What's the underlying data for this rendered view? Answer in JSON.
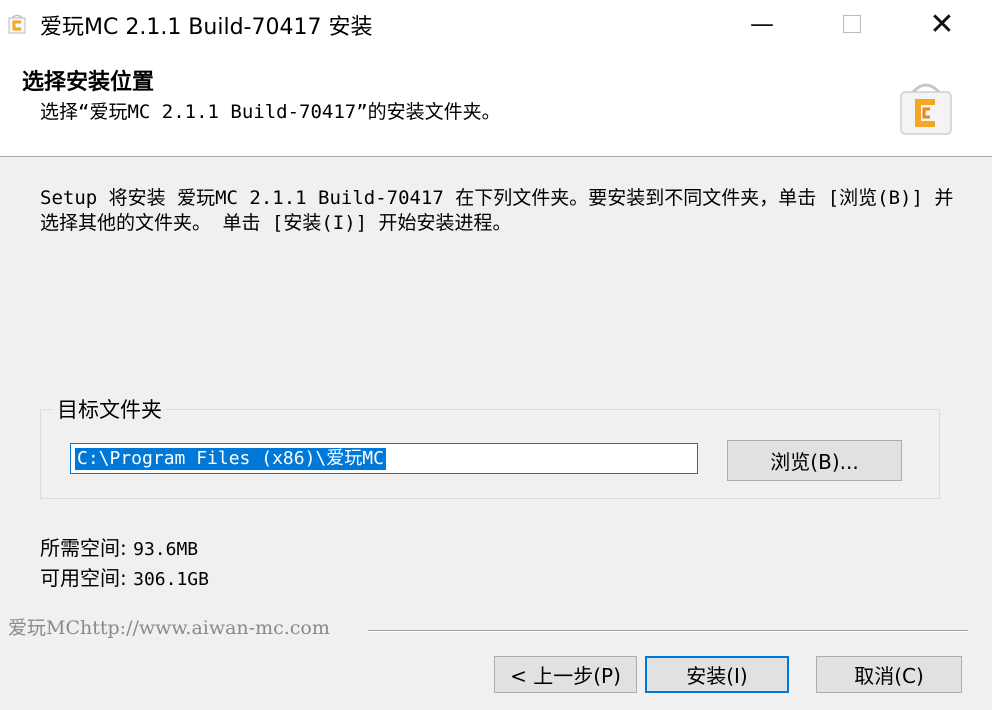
{
  "window": {
    "title": "爱玩MC 2.1.1 Build-70417 安装",
    "minimize_glyph": "—",
    "close_glyph": "✕"
  },
  "header": {
    "title": "选择安装位置",
    "subtitle": "选择“爱玩MC 2.1.1 Build-70417”的安装文件夹。",
    "logo_icon": "aiwanmc-logo-icon"
  },
  "content": {
    "intro": "Setup 将安装 爱玩MC 2.1.1 Build-70417 在下列文件夹。要安装到不同文件夹，单击 [浏览(B)] 并选择其他的文件夹。 单击 [安装(I)] 开始安装进程。",
    "destination": {
      "group_label": "目标文件夹",
      "path_value": "C:\\Program Files (x86)\\爱玩MC",
      "browse_label": "浏览(B)..."
    },
    "space_required_label": "所需空间:",
    "space_required_value": "93.6MB",
    "space_available_label": "可用空间:",
    "space_available_value": "306.1GB"
  },
  "footer": {
    "brand_text": "爱玩MChttp://www.aiwan-mc.com",
    "back_label": "< 上一步(P)",
    "install_label": "安装(I)",
    "cancel_label": "取消(C)"
  },
  "colors": {
    "accent": "#0078d7",
    "panel_bg": "#f0f0f0",
    "logo_orange": "#f5a623"
  }
}
